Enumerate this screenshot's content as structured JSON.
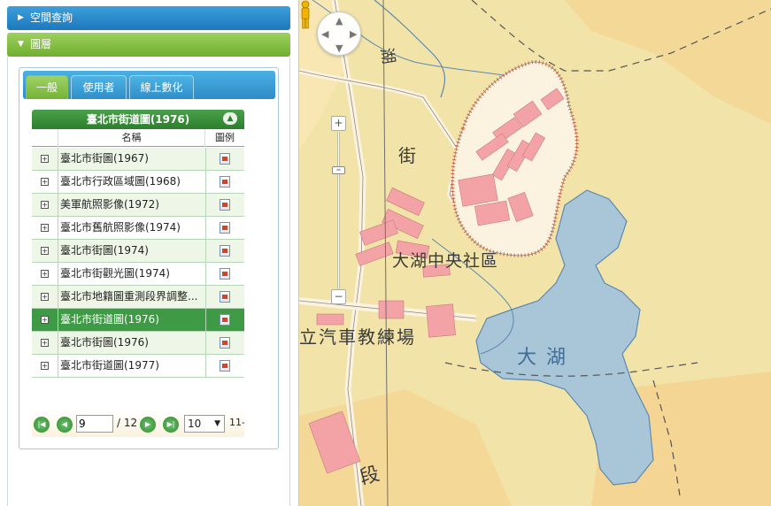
{
  "panel": {
    "spatial_query": {
      "label": "空間查詢",
      "icon": "triangle-right-icon"
    },
    "layers": {
      "label": "圖層",
      "icon": "triangle-down-icon"
    }
  },
  "tabs": [
    {
      "label": "一般",
      "active": true
    },
    {
      "label": "使用者",
      "active": false
    },
    {
      "label": "線上數化",
      "active": false
    }
  ],
  "grid": {
    "title": "臺北市街道圖(1976)",
    "columns": {
      "name": "名稱",
      "legend": "圖例"
    },
    "rows": [
      {
        "name": "臺北市街圖(1967)"
      },
      {
        "name": "臺北市行政區域圖(1968)"
      },
      {
        "name": "美軍航照影像(1972)"
      },
      {
        "name": "臺北市舊航照影像(1974)"
      },
      {
        "name": "臺北市街圖(1974)"
      },
      {
        "name": "臺北市街觀光圖(1974)"
      },
      {
        "name": "臺北市地籍圖重測段界調整..."
      },
      {
        "name": "臺北市街道圖(1976)",
        "selected": true
      },
      {
        "name": "臺北市街圖(1976)"
      },
      {
        "name": "臺北市街道圖(1977)"
      }
    ]
  },
  "pager": {
    "current_page": "9",
    "total_pages": "/ 12",
    "page_size": "10",
    "info": "11-"
  },
  "map": {
    "labels": {
      "center": "大湖中央社區",
      "lake": "大 湖",
      "street": "街",
      "lake_edge": "湖",
      "school": "立汽車教練場",
      "section": "段"
    },
    "colors": {
      "base": "#f2e3a8",
      "hill": "#f6cf8a",
      "lake": "#a9c6d8",
      "building": "#f3a3a6",
      "road": "#fbf2df",
      "grid_line": "#6f6f6f"
    },
    "controls": {
      "pan": "pan-control",
      "zoom_in": "+",
      "zoom_out": "−",
      "zoom_level_fraction": 0.22
    }
  }
}
